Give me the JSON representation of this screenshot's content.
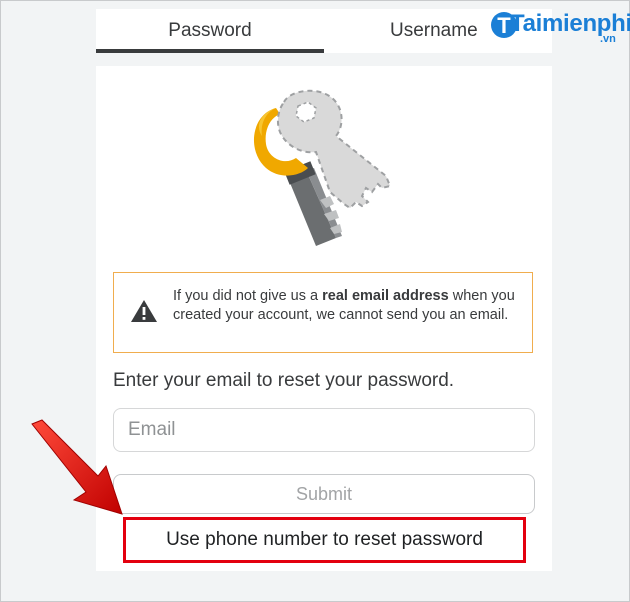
{
  "tabs": [
    {
      "label": "Password",
      "active": true
    },
    {
      "label": "Username",
      "active": false
    }
  ],
  "watermark": {
    "text": "Taimienphi",
    "suffix": ".vn"
  },
  "warning": {
    "icon": "warning-triangle-icon",
    "text_before": "If you did not give us a ",
    "text_bold": "real email address",
    "text_after": " when you created your account, we cannot send you an email."
  },
  "form": {
    "prompt": "Enter your email to reset your password.",
    "email_placeholder": "Email",
    "email_value": "",
    "submit_label": "Submit",
    "phone_link_label": "Use phone number to reset password"
  },
  "colors": {
    "warning_border": "#f0ad4e",
    "highlight_box": "#e3000f",
    "arrow": "#e3000f",
    "tab_underline": "#393b3d"
  },
  "illustration": {
    "icon": "keys-icon"
  }
}
